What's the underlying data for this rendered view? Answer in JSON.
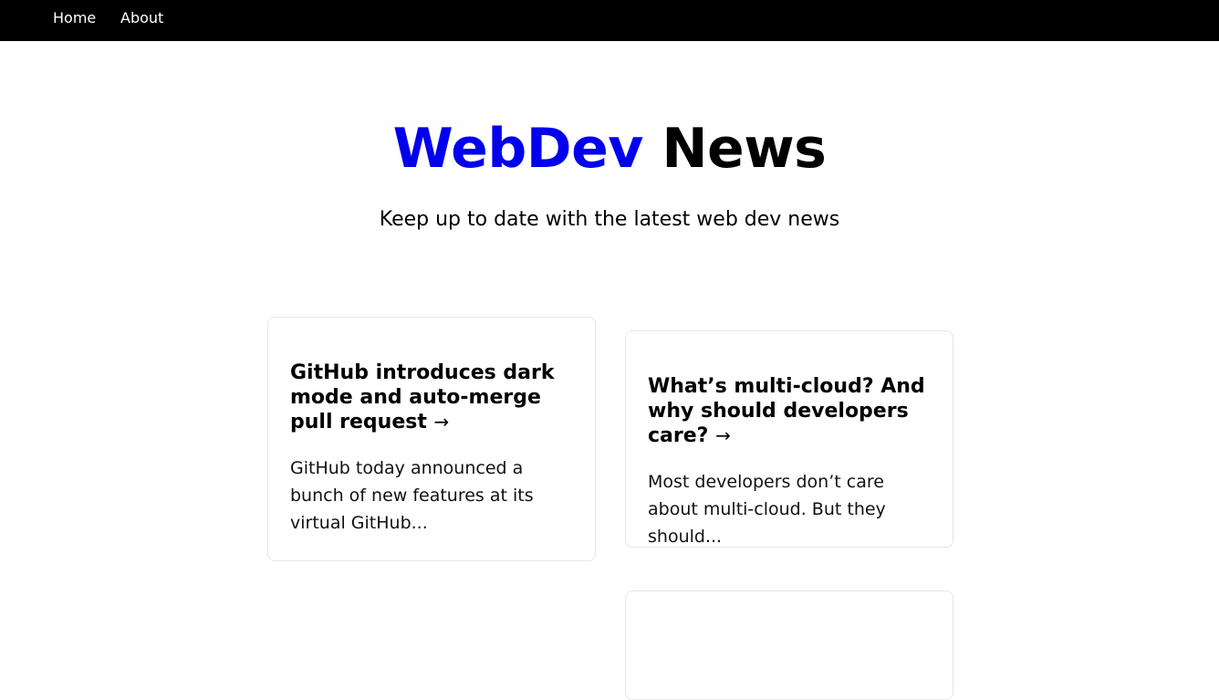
{
  "nav": {
    "home": "Home",
    "about": "About"
  },
  "hero": {
    "title_accent": "WebDev",
    "title_rest": "News",
    "subtitle": "Keep up to date with the latest web dev news"
  },
  "articles": [
    {
      "title": "GitHub introduces dark mode and auto-merge pull request",
      "arrow": "→",
      "excerpt": "GitHub today announced a bunch of new features at its virtual GitHub..."
    },
    {
      "title": "What’s multi-cloud? And why should developers care?",
      "arrow": "→",
      "excerpt": "Most developers don’t care about multi-cloud. But they should..."
    }
  ],
  "colors": {
    "nav_background": "#000000",
    "accent": "#0000ee",
    "card_border": "#e6e6e6"
  }
}
